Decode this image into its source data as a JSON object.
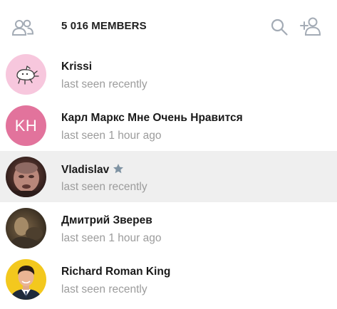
{
  "header": {
    "title": "5 016 MEMBERS",
    "icons": {
      "left": "members-icon",
      "search": "search-icon",
      "add": "add-user-icon"
    }
  },
  "colors": {
    "icon_gray": "#a3abb5",
    "selected_row_bg": "#efefef",
    "status_gray": "#9c9c9c",
    "initials_avatar": "#e2739c",
    "star": "#7f93a3"
  },
  "members": [
    {
      "name": "Krissi",
      "status": "last seen recently"
    },
    {
      "name": "Карл Маркс Мне Очень Нравится",
      "status": "last seen 1 hour ago",
      "initials": "KH"
    },
    {
      "name": "Vladislav",
      "status": "last seen recently",
      "badge": "star-icon"
    },
    {
      "name": "Дмитрий Зверев",
      "status": "last seen 1 hour ago"
    },
    {
      "name": "Richard Roman King",
      "status": "last seen recently"
    }
  ]
}
